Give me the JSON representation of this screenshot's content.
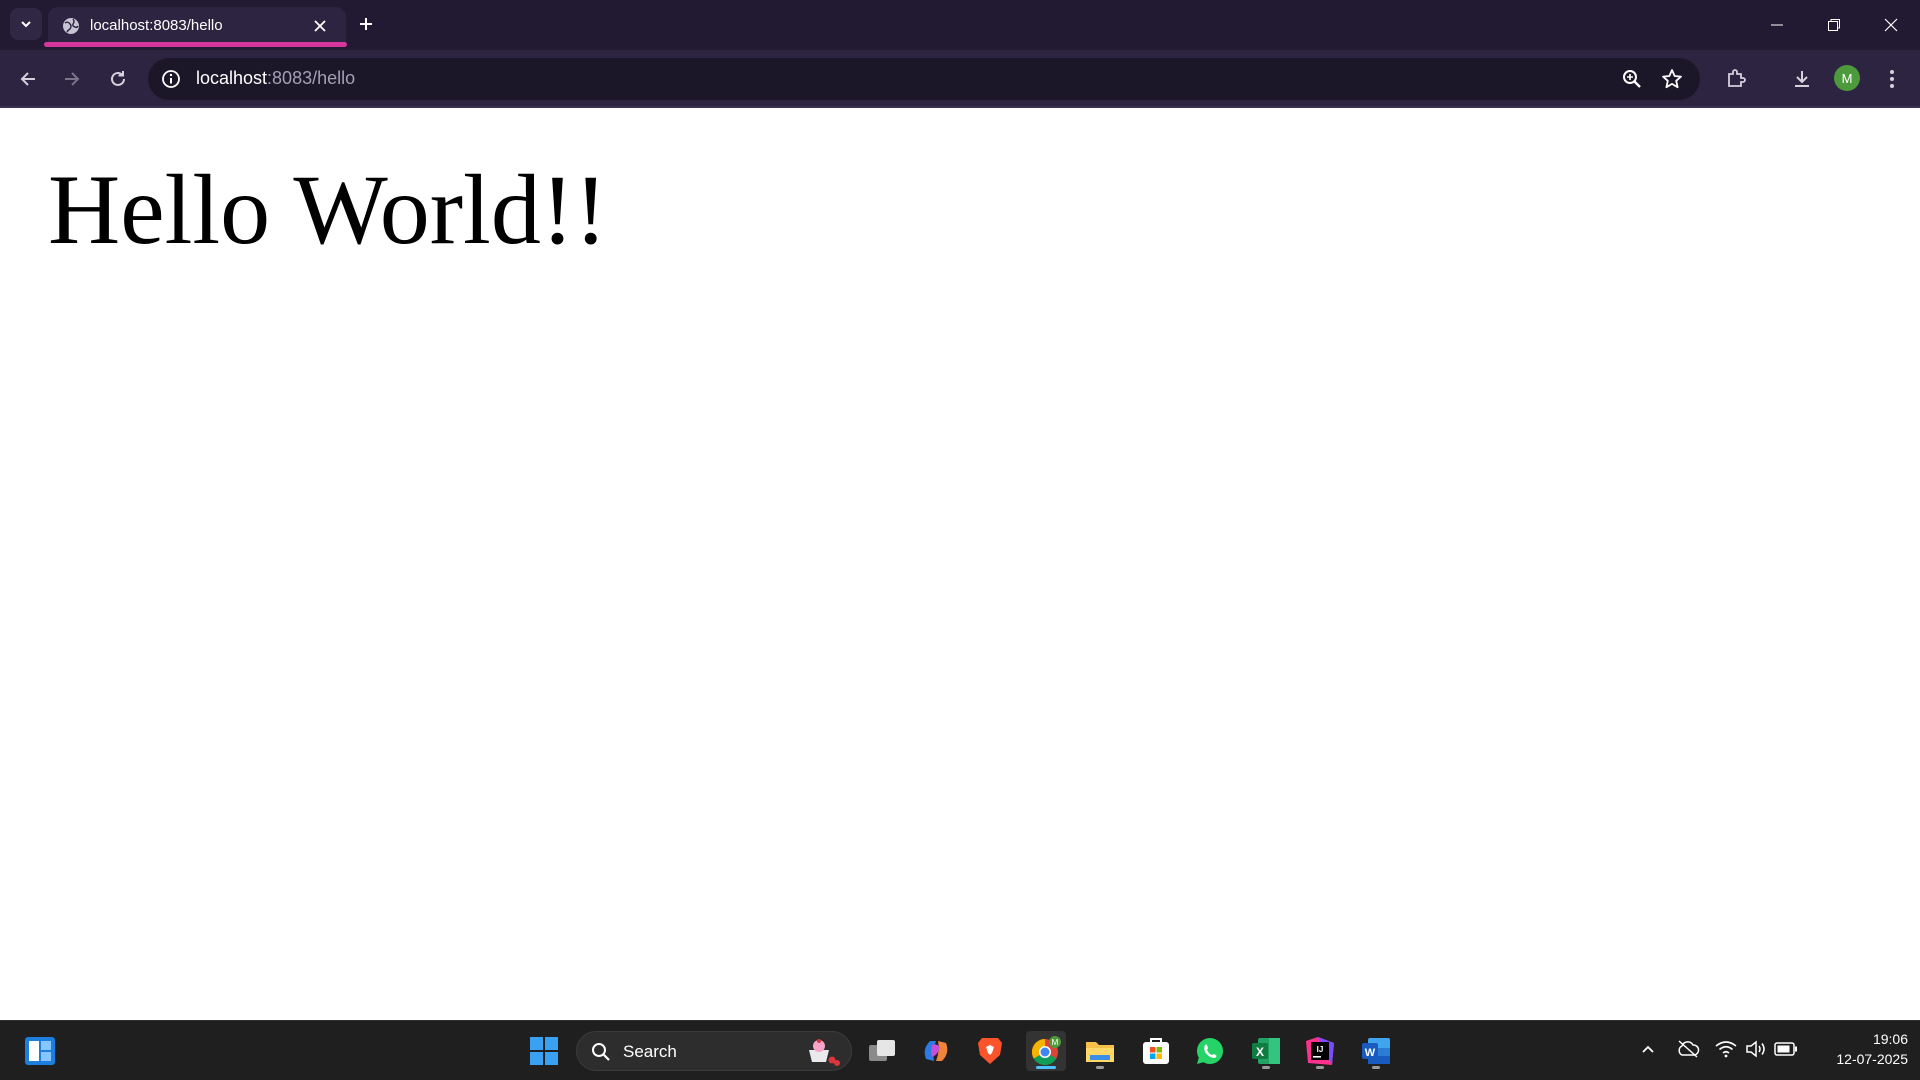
{
  "browser": {
    "tab": {
      "title": "localhost:8083/hello",
      "favicon": "globe-icon"
    },
    "address": {
      "host": "localhost",
      "rest": ":8083/hello"
    },
    "profile_initial": "M",
    "accent_color": "#d6359b"
  },
  "page": {
    "heading": "Hello World!!"
  },
  "taskbar": {
    "search_label": "Search",
    "apps": [
      "widgets",
      "start",
      "task-view",
      "copilot",
      "brave",
      "chrome",
      "file-explorer",
      "microsoft-store",
      "whatsapp",
      "excel",
      "intellij",
      "word"
    ],
    "time": "19:06",
    "date": "12-07-2025"
  }
}
